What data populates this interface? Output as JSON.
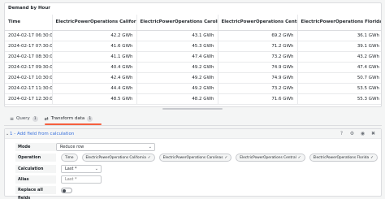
{
  "panel": {
    "title": "Demand by Hour",
    "columns": [
      "Time",
      "ElectricPowerOperations California",
      "ElectricPowerOperations Carolinas",
      "ElectricPowerOperations Central",
      "ElectricPowerOperations Florida"
    ],
    "rows": [
      [
        "2024-02-17 06:30:00",
        "42.2 GWh",
        "43.1 GWh",
        "69.2 GWh",
        "36.1 GWh"
      ],
      [
        "2024-02-17 07:30:00",
        "41.6 GWh",
        "45.3 GWh",
        "71.2 GWh",
        "39.1 GWh"
      ],
      [
        "2024-02-17 08:30:00",
        "41.1 GWh",
        "47.4 GWh",
        "73.2 GWh",
        "43.2 GWh"
      ],
      [
        "2024-02-17 09:30:00",
        "40.4 GWh",
        "49.2 GWh",
        "74.9 GWh",
        "47.4 GWh"
      ],
      [
        "2024-02-17 10:30:00",
        "42.4 GWh",
        "49.2 GWh",
        "74.9 GWh",
        "50.7 GWh"
      ],
      [
        "2024-02-17 11:30:00",
        "44.4 GWh",
        "49.2 GWh",
        "73.2 GWh",
        "53.5 GWh"
      ],
      [
        "2024-02-17 12:30:00",
        "48.5 GWh",
        "48.2 GWh",
        "71.6 GWh",
        "55.3 GWh"
      ]
    ]
  },
  "tabs": [
    {
      "label": "Query",
      "count": "1",
      "icon": "database-icon"
    },
    {
      "label": "Transform data",
      "count": "1",
      "icon": "transform-icon"
    }
  ],
  "editor": {
    "title": "1 - Add field from calculation",
    "mode_label": "Mode",
    "mode_value": "Reduce row",
    "operation_label": "Operation",
    "operation_chips": [
      "Time",
      "ElectricPowerOperations California",
      "ElectricPowerOperations Carolinas",
      "ElectricPowerOperations Central",
      "ElectricPowerOperations Florida"
    ],
    "calculation_label": "Calculation",
    "calculation_value": "Last *",
    "alias_label": "Alias",
    "alias_placeholder": "Last *",
    "replace_label": "Replace all fields"
  },
  "colors": {
    "accent": "#f55f3e",
    "link": "#3871dc"
  }
}
